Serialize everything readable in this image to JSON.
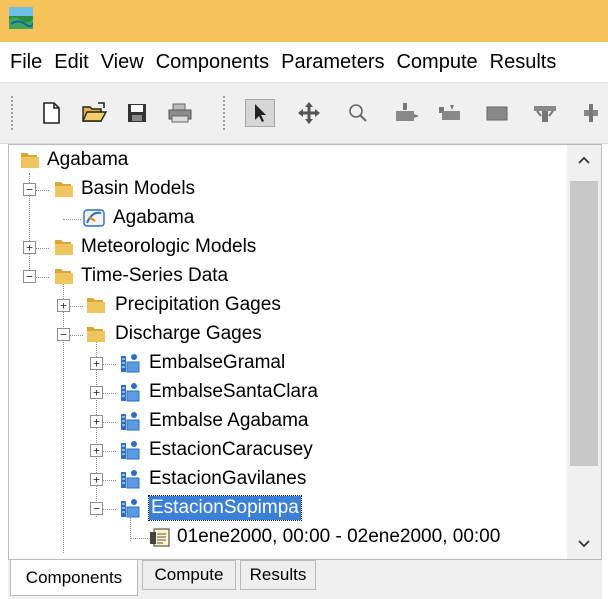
{
  "menu": [
    "File",
    "Edit",
    "View",
    "Components",
    "Parameters",
    "Compute",
    "Results"
  ],
  "toolbar": {
    "buttons": [
      "new-file-icon",
      "open-folder-icon",
      "save-icon",
      "print-icon",
      "pointer-icon",
      "move-icon",
      "zoom-icon",
      "subbasin-icon",
      "reach-icon",
      "reservoir-icon",
      "junction-icon",
      "diversion-icon"
    ]
  },
  "tree": {
    "root": "Agabama",
    "basin_models": "Basin Models",
    "basin_model_item": "Agabama",
    "meteorologic_models": "Meteorologic Models",
    "time_series_data": "Time-Series Data",
    "precipitation_gages": "Precipitation Gages",
    "discharge_gages": "Discharge Gages",
    "gages": [
      "EmbalseGramal",
      "EmbalseSantaClara",
      "Embalse Agabama",
      "EstacionCaracusey",
      "EstacionGavilanes",
      "EstacionSopimpa"
    ],
    "time_window": "01ene2000, 00:00 - 02ene2000, 00:00"
  },
  "tabs": [
    "Components",
    "Compute",
    "Results"
  ],
  "active_tab": "Components",
  "selected_node": "EstacionSopimpa",
  "colors": {
    "titlebar": "#f7c25a",
    "selection": "#3b7fd6",
    "folder": "#e8bd55",
    "gage_icon": "#2a6fc4"
  }
}
